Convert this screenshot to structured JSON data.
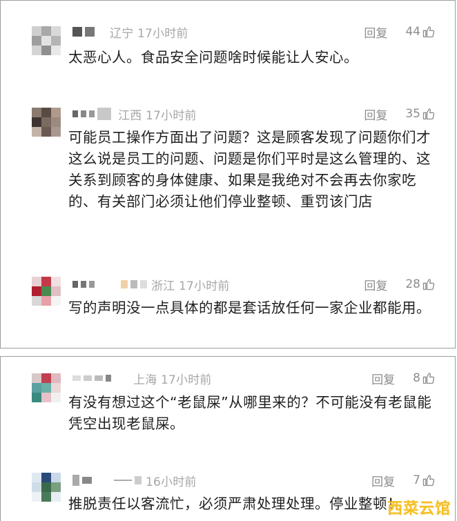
{
  "ui": {
    "reply_label": "回复",
    "accent_like_icon_color": "#8c8c8c",
    "time_color": "#a6a6a6"
  },
  "comments": [
    {
      "loc_time": "辽宁 17小时前",
      "likes": "44",
      "text": "太恶心人。食品安全问题啥时候能让人安心。"
    },
    {
      "loc_time": "江西 17小时前",
      "likes": "35",
      "text": "可能员工操作方面出了问题？这是顾客发现了问题你们才这么说是员工的问题、问题是你们平时是这么管理的、这关系到顾客的身体健康、如果是我绝对不会再去你家吃的、有关部门必须让他们停业整顿、重罚该门店"
    },
    {
      "loc_time": "浙江 17小时前",
      "likes": "28",
      "text": "写的声明没一点具体的都是套话放任何一家企业都能用。"
    },
    {
      "loc_time": "上海 17小时前",
      "likes": "8",
      "text": "有没有想过这个“老鼠屎”从哪里来的？不可能没有老鼠能凭空出现老鼠屎。"
    },
    {
      "loc_time": "16小时前",
      "likes": "7",
      "text": "推脱责任以客流忙，必须严肃处理处理。停业整顿！"
    }
  ],
  "watermark": "西菜云馆"
}
